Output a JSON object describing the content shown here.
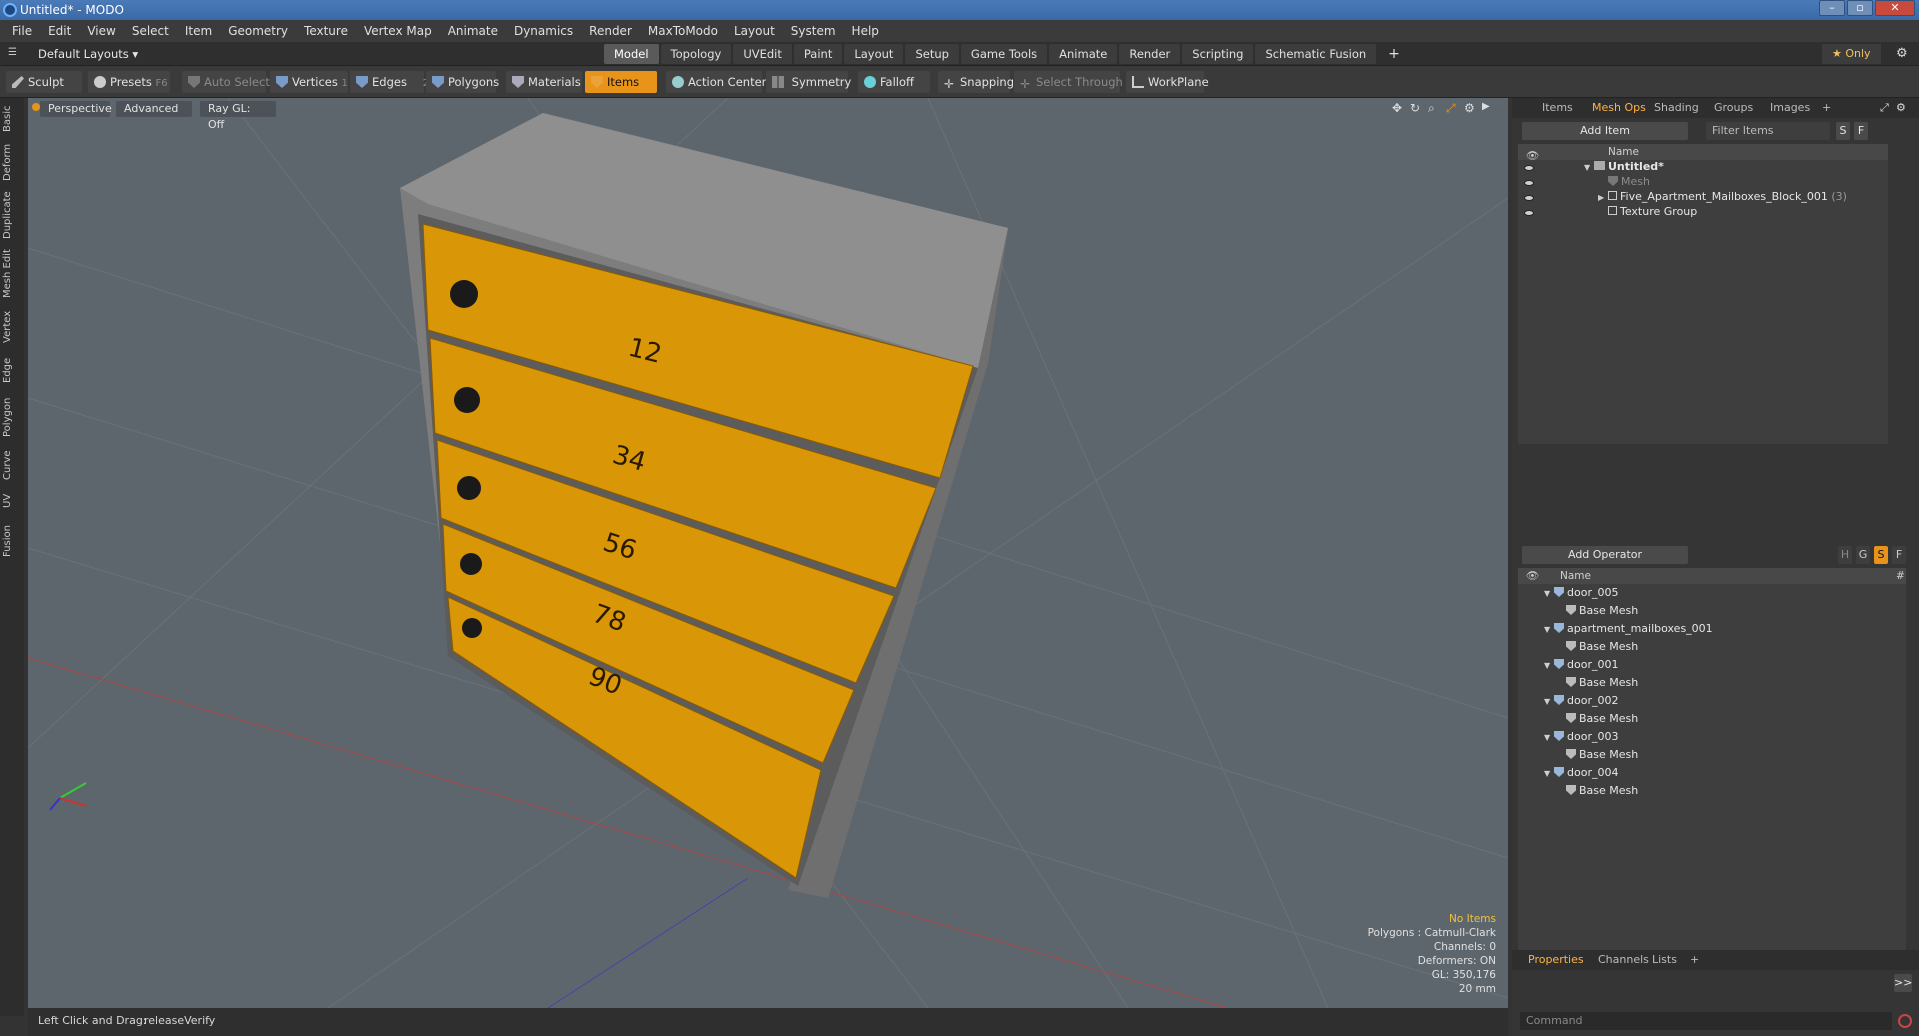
{
  "window": {
    "title": "Untitled* - MODO",
    "min": "–",
    "max": "▫",
    "close": "✕"
  },
  "menu": [
    "File",
    "Edit",
    "View",
    "Select",
    "Item",
    "Geometry",
    "Texture",
    "Vertex Map",
    "Animate",
    "Dynamics",
    "Render",
    "MaxToModo",
    "Layout",
    "System",
    "Help"
  ],
  "layouts": {
    "current": "Default Layouts ▾",
    "tabs": [
      "Model",
      "Topology",
      "UVEdit",
      "Paint",
      "Layout",
      "Setup",
      "Game Tools",
      "Animate",
      "Render",
      "Scripting",
      "Schematic Fusion"
    ],
    "active_tab": "Model",
    "add": "+",
    "only_label": "★  Only"
  },
  "toolbar": {
    "sculpt": "Sculpt",
    "presets": "Presets",
    "presets_key": "F6",
    "auto_select": "Auto Select",
    "vertices": "Vertices",
    "vertices_key": "1",
    "edges": "Edges",
    "edges_key": "2",
    "polygons": "Polygons",
    "materials": "Materials",
    "items": "Items",
    "action_center": "Action Center",
    "symmetry": "Symmetry",
    "falloff": "Falloff",
    "snapping": "Snapping",
    "select_through": "Select Through",
    "workplane": "WorkPlane"
  },
  "left_tabs": [
    "Basic",
    "Deform",
    "Duplicate",
    "Mesh Edit",
    "Vertex",
    "Edge",
    "Polygon",
    "Curve",
    "UV",
    "Fusion"
  ],
  "viewport": {
    "view": "Perspective",
    "shading": "Advanced",
    "raygl": "Ray GL: Off",
    "stats": {
      "selection": "No Items",
      "polygons": "Polygons : Catmull-Clark",
      "channels": "Channels: 0",
      "deformers": "Deformers: ON",
      "gl": "GL: 350,176",
      "unit": "20 mm"
    },
    "mailbox_numbers": [
      "12",
      "34",
      "56",
      "78",
      "90"
    ],
    "colors": {
      "bg": "#5e666d",
      "door": "#d99606",
      "frame": "#8a8a8a"
    }
  },
  "status": {
    "hint": "Left Click and Drag:",
    "action": "releaseVerify"
  },
  "items_panel": {
    "tabs": [
      "Items",
      "Mesh Ops",
      "Shading",
      "Groups",
      "Images",
      "+"
    ],
    "active_tab": "Mesh Ops",
    "add_item": "Add Item",
    "filter": "Filter Items",
    "s": "S",
    "f": "F",
    "col_name": "Name",
    "tree": [
      {
        "label": "Untitled*",
        "level": 0,
        "bold": true
      },
      {
        "label": "Mesh",
        "level": 1,
        "grey": true
      },
      {
        "label": "Five_Apartment_Mailboxes_Block_001",
        "count": "(3)",
        "level": 1
      },
      {
        "label": "Texture Group",
        "level": 1
      }
    ]
  },
  "ops_panel": {
    "add_operator": "Add Operator",
    "col_name": "Name",
    "col_hash": "#",
    "flags": [
      "H",
      "G",
      "S",
      "F"
    ],
    "items": [
      {
        "name": "door_005",
        "child": "Base Mesh"
      },
      {
        "name": "apartment_mailboxes_001",
        "child": "Base Mesh"
      },
      {
        "name": "door_001",
        "child": "Base Mesh"
      },
      {
        "name": "door_002",
        "child": "Base Mesh"
      },
      {
        "name": "door_003",
        "child": "Base Mesh"
      },
      {
        "name": "door_004",
        "child": "Base Mesh"
      }
    ]
  },
  "bottom_panel": {
    "tabs": [
      "Properties",
      "Channels",
      "Lists",
      "+"
    ],
    "active_tab": "Properties",
    "command_placeholder": "Command",
    "expand": ">>"
  }
}
